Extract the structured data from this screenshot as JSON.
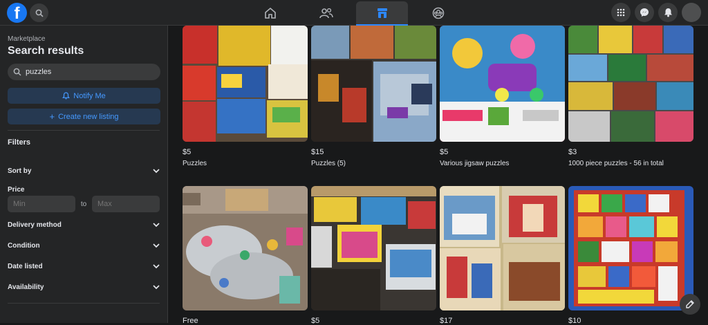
{
  "topbar": {
    "nav": [
      "home-icon",
      "friends-icon",
      "marketplace-icon",
      "groups-icon"
    ],
    "active_nav": "marketplace-icon"
  },
  "sidebar": {
    "breadcrumb": "Marketplace",
    "title": "Search results",
    "search_value": "puzzles",
    "notify_label": "Notify Me",
    "create_label": "Create new listing",
    "filters_title": "Filters",
    "sort_label": "Sort by",
    "price_label": "Price",
    "price_min_placeholder": "Min",
    "price_to": "to",
    "price_max_placeholder": "Max",
    "filter_items": [
      "Delivery method",
      "Condition",
      "Date listed",
      "Availability"
    ]
  },
  "listings": [
    {
      "price": "$5",
      "title": "Puzzles"
    },
    {
      "price": "$15",
      "title": "Puzzles (5)"
    },
    {
      "price": "$5",
      "title": "Various jigsaw puzzles"
    },
    {
      "price": "$3",
      "title": "1000 piece puzzles - 56 in total"
    },
    {
      "price": "Free",
      "title": ""
    },
    {
      "price": "$5",
      "title": ""
    },
    {
      "price": "$17",
      "title": ""
    },
    {
      "price": "$10",
      "title": ""
    }
  ],
  "colors": {
    "accent": "#2d88ff",
    "brand": "#1877f2",
    "background": "#18191a",
    "surface": "#242526"
  }
}
